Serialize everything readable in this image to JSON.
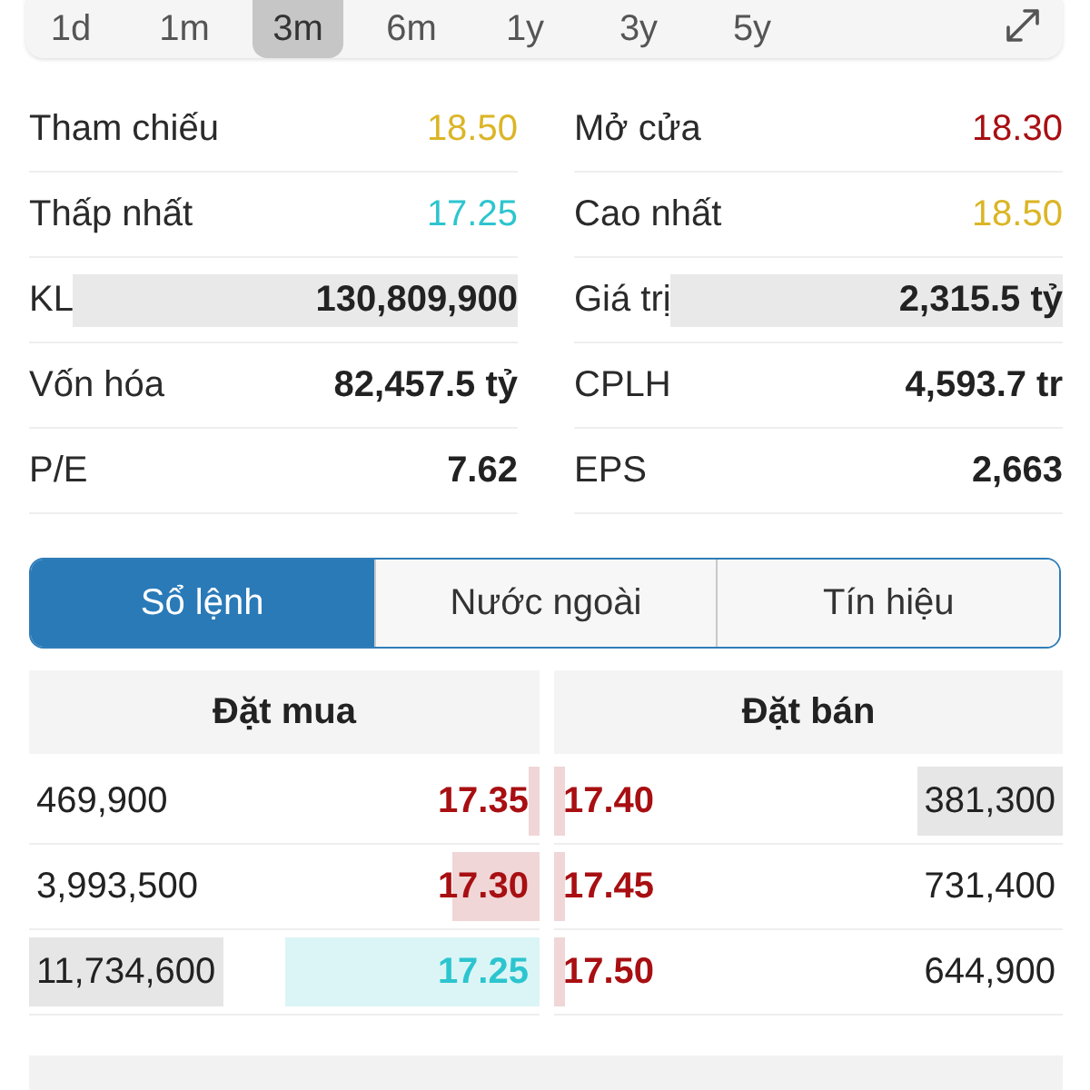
{
  "periods": [
    {
      "label": "1d",
      "selected": false
    },
    {
      "label": "1m",
      "selected": false
    },
    {
      "label": "3m",
      "selected": true
    },
    {
      "label": "6m",
      "selected": false
    },
    {
      "label": "1y",
      "selected": false
    },
    {
      "label": "3y",
      "selected": false
    },
    {
      "label": "5y",
      "selected": false
    }
  ],
  "stats": [
    {
      "label": "Tham chiếu",
      "value": "18.50",
      "color": "#dbb526",
      "highlighted": false
    },
    {
      "label": "Mở cửa",
      "value": "18.30",
      "color": "#a80f12",
      "highlighted": false
    },
    {
      "label": "Thấp nhất",
      "value": "17.25",
      "color": "#2cc5cf",
      "highlighted": false
    },
    {
      "label": "Cao nhất",
      "value": "18.50",
      "color": "#dbb526",
      "highlighted": false
    },
    {
      "label": "KL",
      "value": "130,809,900",
      "highlighted": true
    },
    {
      "label": "Giá trị",
      "value": "2,315.5 tỷ",
      "highlighted": true
    },
    {
      "label": "Vốn hóa",
      "value": "82,457.5 tỷ",
      "highlighted": false
    },
    {
      "label": "CPLH",
      "value": "4,593.7 tr",
      "highlighted": false
    },
    {
      "label": "P/E",
      "value": "7.62",
      "highlighted": false
    },
    {
      "label": "EPS",
      "value": "2,663",
      "highlighted": false
    }
  ],
  "tabs": [
    {
      "label": "Sổ lệnh",
      "selected": true
    },
    {
      "label": "Nước ngoài",
      "selected": false
    },
    {
      "label": "Tín hiệu",
      "selected": false
    }
  ],
  "order_book": {
    "buy_header": "Đặt mua",
    "sell_header": "Đặt bán",
    "rows": [
      {
        "bid": {
          "volume": "469,900",
          "highlighted": false,
          "price": "17.35",
          "color": "#a80f12",
          "level": 0.02
        },
        "ask": {
          "price": "17.40",
          "color": "#a80f12",
          "level": 0.02,
          "volume": "381,300",
          "highlighted": true
        }
      },
      {
        "bid": {
          "volume": "3,993,500",
          "highlighted": false,
          "price": "17.30",
          "color": "#a80f12",
          "level": 0.17
        },
        "ask": {
          "price": "17.45",
          "color": "#a80f12",
          "level": 0.02,
          "volume": "731,400",
          "highlighted": false
        }
      },
      {
        "bid": {
          "volume": "11,734,600",
          "highlighted": true,
          "price": "17.25",
          "color": "#2cc5cf",
          "level": 0.5
        },
        "ask": {
          "price": "17.50",
          "color": "#a80f12",
          "level": 0.02,
          "volume": "644,900",
          "highlighted": false
        }
      }
    ]
  }
}
